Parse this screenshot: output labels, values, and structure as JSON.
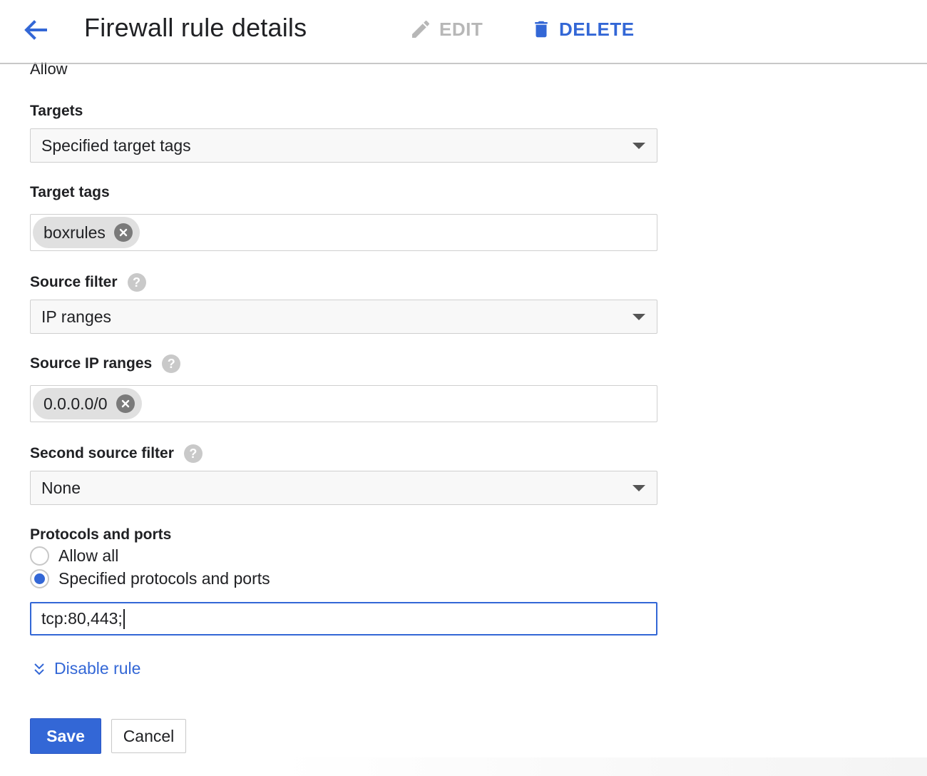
{
  "header": {
    "title": "Firewall rule details",
    "edit_label": "EDIT",
    "delete_label": "DELETE"
  },
  "action": {
    "value": "Allow"
  },
  "targets": {
    "label": "Targets",
    "value": "Specified target tags"
  },
  "target_tags": {
    "label": "Target tags",
    "chips": [
      "boxrules"
    ]
  },
  "source_filter": {
    "label": "Source filter",
    "value": "IP ranges"
  },
  "source_ip_ranges": {
    "label": "Source IP ranges",
    "chips": [
      "0.0.0.0/0"
    ]
  },
  "second_source_filter": {
    "label": "Second source filter",
    "value": "None"
  },
  "protocols": {
    "label": "Protocols and ports",
    "options": [
      "Allow all",
      "Specified protocols and ports"
    ],
    "selected": "Specified protocols and ports",
    "input_value": "tcp:80,443;"
  },
  "disable_rule": {
    "label": "Disable rule"
  },
  "buttons": {
    "save": "Save",
    "cancel": "Cancel"
  },
  "colors": {
    "accent": "#3367d6",
    "disabled": "#b7b7b7"
  },
  "icons": {
    "back": "arrow-left-icon",
    "edit": "pencil-icon",
    "delete": "trash-icon",
    "help": "help-icon",
    "chip_remove": "close-circle-icon",
    "expand": "chevron-down-double-icon",
    "dropdown": "caret-down-icon"
  }
}
